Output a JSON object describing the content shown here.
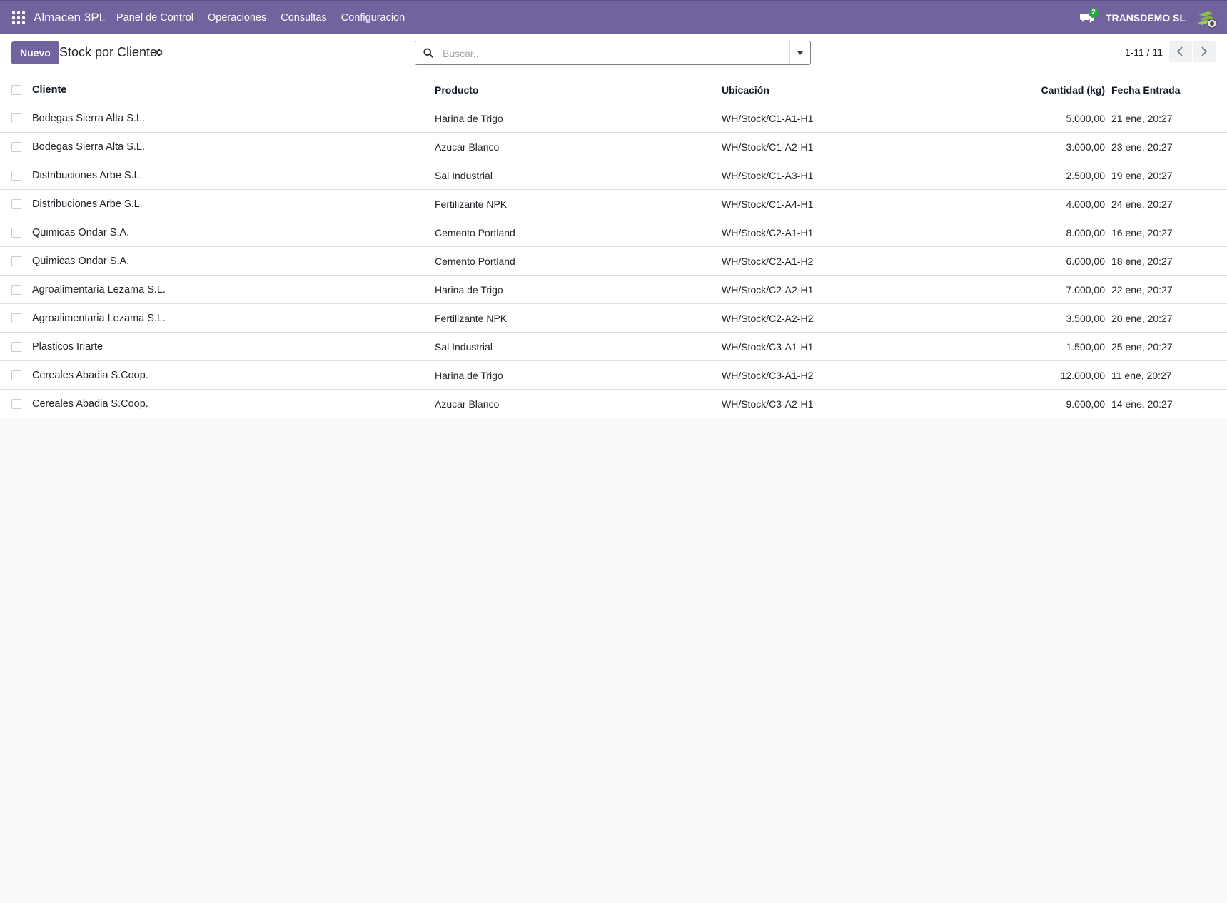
{
  "navbar": {
    "app_name": "Almacen 3PL",
    "menu": [
      "Panel de Control",
      "Operaciones",
      "Consultas",
      "Configuracion"
    ],
    "chat_badge": "2",
    "company": "TRANSDEMO SL",
    "colors": {
      "bar": "#71639e",
      "badge": "#28a745"
    }
  },
  "control": {
    "new_button": "Nuevo",
    "title": "Stock por Cliente",
    "search_placeholder": "Buscar...",
    "pager": "1-11 / 11"
  },
  "table": {
    "headers": {
      "cliente": "Cliente",
      "producto": "Producto",
      "ubicacion": "Ubicación",
      "cantidad": "Cantidad (kg)",
      "fecha": "Fecha Entrada"
    },
    "rows": [
      {
        "cliente": "Bodegas Sierra Alta S.L.",
        "producto": "Harina de Trigo",
        "ubicacion": "WH/Stock/C1-A1-H1",
        "cantidad": "5.000,00",
        "fecha": "21 ene, 20:27"
      },
      {
        "cliente": "Bodegas Sierra Alta S.L.",
        "producto": "Azucar Blanco",
        "ubicacion": "WH/Stock/C1-A2-H1",
        "cantidad": "3.000,00",
        "fecha": "23 ene, 20:27"
      },
      {
        "cliente": "Distribuciones Arbe S.L.",
        "producto": "Sal Industrial",
        "ubicacion": "WH/Stock/C1-A3-H1",
        "cantidad": "2.500,00",
        "fecha": "19 ene, 20:27"
      },
      {
        "cliente": "Distribuciones Arbe S.L.",
        "producto": "Fertilizante NPK",
        "ubicacion": "WH/Stock/C1-A4-H1",
        "cantidad": "4.000,00",
        "fecha": "24 ene, 20:27"
      },
      {
        "cliente": "Quimicas Ondar S.A.",
        "producto": "Cemento Portland",
        "ubicacion": "WH/Stock/C2-A1-H1",
        "cantidad": "8.000,00",
        "fecha": "16 ene, 20:27"
      },
      {
        "cliente": "Quimicas Ondar S.A.",
        "producto": "Cemento Portland",
        "ubicacion": "WH/Stock/C2-A1-H2",
        "cantidad": "6.000,00",
        "fecha": "18 ene, 20:27"
      },
      {
        "cliente": "Agroalimentaria Lezama S.L.",
        "producto": "Harina de Trigo",
        "ubicacion": "WH/Stock/C2-A2-H1",
        "cantidad": "7.000,00",
        "fecha": "22 ene, 20:27"
      },
      {
        "cliente": "Agroalimentaria Lezama S.L.",
        "producto": "Fertilizante NPK",
        "ubicacion": "WH/Stock/C2-A2-H2",
        "cantidad": "3.500,00",
        "fecha": "20 ene, 20:27"
      },
      {
        "cliente": "Plasticos Iriarte",
        "producto": "Sal Industrial",
        "ubicacion": "WH/Stock/C3-A1-H1",
        "cantidad": "1.500,00",
        "fecha": "25 ene, 20:27"
      },
      {
        "cliente": "Cereales Abadia S.Coop.",
        "producto": "Harina de Trigo",
        "ubicacion": "WH/Stock/C3-A1-H2",
        "cantidad": "12.000,00",
        "fecha": "11 ene, 20:27"
      },
      {
        "cliente": "Cereales Abadia S.Coop.",
        "producto": "Azucar Blanco",
        "ubicacion": "WH/Stock/C3-A2-H1",
        "cantidad": "9.000,00",
        "fecha": "14 ene, 20:27"
      }
    ]
  }
}
